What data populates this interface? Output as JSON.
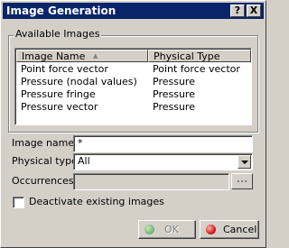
{
  "window": {
    "title": "Image Generation",
    "help_label": "?",
    "close_label": "X"
  },
  "available_images": {
    "group_label": "Available Images",
    "columns": [
      "Image Name",
      "Physical Type"
    ],
    "rows": [
      {
        "name": "Point force vector",
        "type": "Point force vector"
      },
      {
        "name": "Pressure (nodal values)",
        "type": "Pressure"
      },
      {
        "name": "Pressure fringe",
        "type": "Pressure"
      },
      {
        "name": "Pressure vector",
        "type": "Pressure"
      }
    ]
  },
  "fields": {
    "image_name_label": "Image name:",
    "image_name_value": "*",
    "physical_type_label": "Physical type:",
    "physical_type_value": "All",
    "occurrences_label": "Occurrences:",
    "occurrences_value": "",
    "browse_label": "..."
  },
  "options": {
    "deactivate_label": "Deactivate existing images",
    "deactivate_checked": false
  },
  "buttons": {
    "ok_label": "OK",
    "cancel_label": "Cancel"
  },
  "colors": {
    "face": "#d4d0c8",
    "titlebar": "#0a246a",
    "cancel_icon": "#d42020",
    "ok_icon": "#5aa85a"
  },
  "icons": {
    "sort": "sort-ascending-icon",
    "ok": "ok-green-circle-icon",
    "cancel": "cancel-red-circle-icon"
  }
}
